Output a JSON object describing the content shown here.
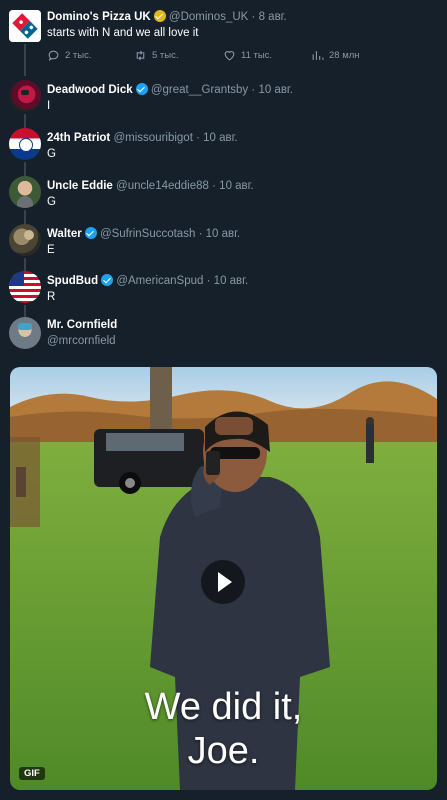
{
  "main_tweet": {
    "name": "Domino's Pizza UK",
    "handle": "@Dominos_UK",
    "dot": "·",
    "time": "8 авг.",
    "text": "starts with N and we all love it",
    "replies": "2 тыс.",
    "retweets": "5 тыс.",
    "likes": "11 тыс.",
    "views": "28 млн"
  },
  "replies": [
    {
      "name": "Deadwood Dick",
      "handle": "@great__Grantsby",
      "dot": "·",
      "time": "10 авг.",
      "text": "I",
      "verified": true
    },
    {
      "name": "24th Patriot",
      "handle": "@missouribigot",
      "dot": "·",
      "time": "10 авг.",
      "text": "G",
      "verified": false
    },
    {
      "name": "Uncle Eddie",
      "handle": "@uncle14eddie88",
      "dot": "·",
      "time": "10 авг.",
      "text": "G",
      "verified": false
    },
    {
      "name": "Walter",
      "handle": "@SufrinSuccotash",
      "dot": "·",
      "time": "10 авг.",
      "text": "E",
      "verified": true
    },
    {
      "name": "SpudBud",
      "handle": "@AmericanSpud",
      "dot": "·",
      "time": "10 авг.",
      "text": "R",
      "verified": true
    }
  ],
  "last_reply": {
    "name": "Mr. Cornfield",
    "handle": "@mrcornfield"
  },
  "media": {
    "caption_line1": "We did it,",
    "caption_line2": "Joe.",
    "badge": "GIF"
  },
  "icons": {
    "reply": "reply-icon",
    "retweet": "retweet-icon",
    "like": "heart-icon",
    "views": "views-icon",
    "verified": "verified-badge-icon",
    "play": "play-icon"
  },
  "colors": {
    "background": "#15202b",
    "secondary_text": "#8899a6",
    "verified_blue": "#1da1f2",
    "verified_gold": "#e2b719",
    "divider": "#38444d"
  }
}
